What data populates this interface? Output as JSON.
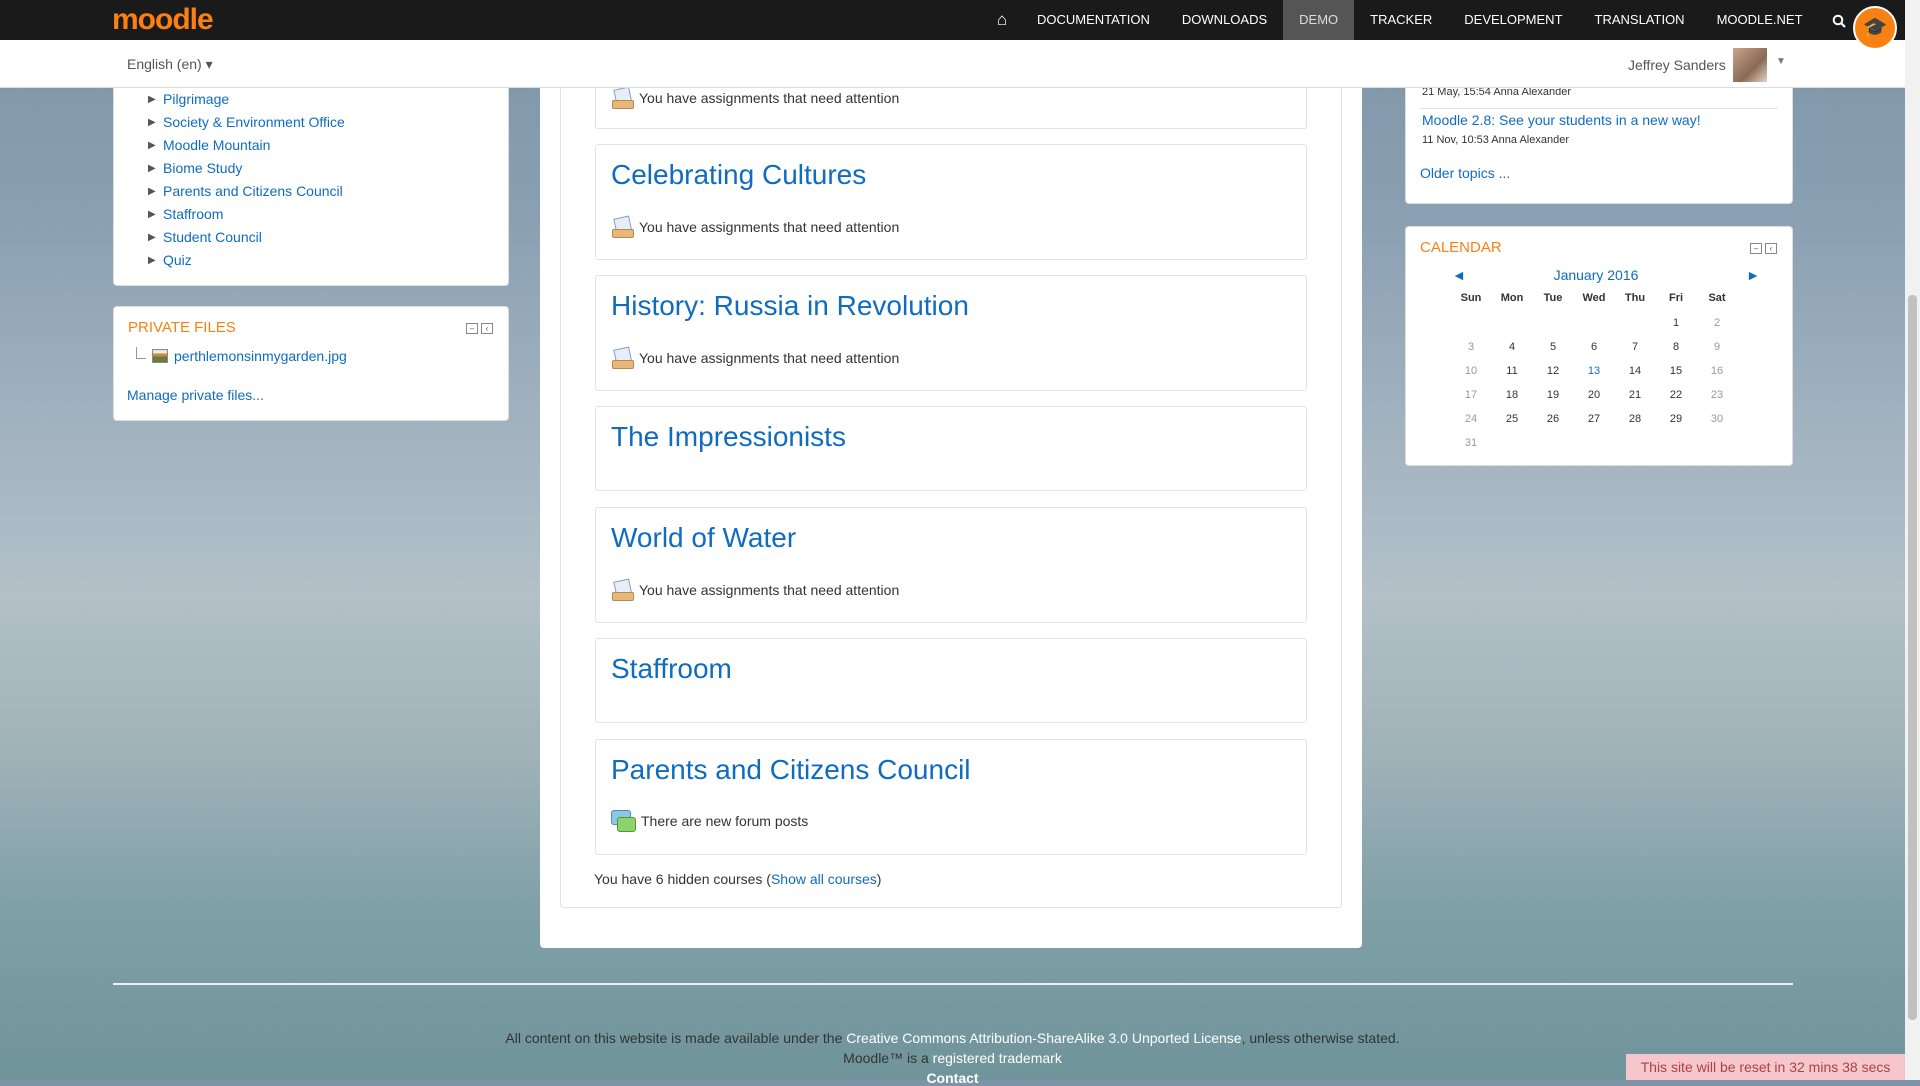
{
  "navbar": {
    "logo": "moodle",
    "home_icon": "⌂",
    "items": [
      "DOCUMENTATION",
      "DOWNLOADS",
      "DEMO",
      "TRACKER",
      "DEVELOPMENT",
      "TRANSLATION",
      "MOODLE.NET"
    ],
    "active_item": "DEMO",
    "search_icon": "search-icon"
  },
  "subbar": {
    "language": "English (en) ▾",
    "user_name": "Jeffrey Sanders"
  },
  "navigation_block": {
    "items": [
      "Pilgrimage",
      "Society & Environment Office",
      "Moodle Mountain",
      "Biome Study",
      "Parents and Citizens Council",
      "Staffroom",
      "Student Council",
      "Quiz"
    ]
  },
  "private_files": {
    "title": "PRIVATE FILES",
    "file": "perthlemonsinmygarden.jpg",
    "manage_link": "Manage private files..."
  },
  "courses": [
    {
      "title": "",
      "notice": "You have assignments that need attention"
    },
    {
      "title": "Celebrating Cultures",
      "notice": "You have assignments that need attention"
    },
    {
      "title": "History: Russia in Revolution",
      "notice": "You have assignments that need attention"
    },
    {
      "title": "The Impressionists",
      "notice": ""
    },
    {
      "title": "World of Water",
      "notice": "You have assignments that need attention"
    },
    {
      "title": "Staffroom",
      "notice": ""
    },
    {
      "title": "Parents and Citizens Council",
      "notice": "There are new forum posts"
    }
  ],
  "hidden_courses": {
    "prefix": "You have 6 hidden courses (",
    "link": "Show all courses",
    "suffix": ")"
  },
  "news": {
    "meta1": "21 May, 15:54  Anna Alexander",
    "link2": "Moodle 2.8: See your students in a new way!",
    "meta2": "11 Nov, 10:53  Anna Alexander",
    "older": "Older topics ..."
  },
  "calendar": {
    "title": "CALENDAR",
    "month": "January 2016",
    "prev": "◄",
    "next": "►",
    "days_of_week": [
      "Sun",
      "Mon",
      "Tue",
      "Wed",
      "Thu",
      "Fri",
      "Sat"
    ],
    "weeks": [
      [
        "",
        "",
        "",
        "",
        "",
        "1",
        "2"
      ],
      [
        "3",
        "4",
        "5",
        "6",
        "7",
        "8",
        "9"
      ],
      [
        "10",
        "11",
        "12",
        "13",
        "14",
        "15",
        "16"
      ],
      [
        "17",
        "18",
        "19",
        "20",
        "21",
        "22",
        "23"
      ],
      [
        "24",
        "25",
        "26",
        "27",
        "28",
        "29",
        "30"
      ],
      [
        "31",
        "",
        "",
        "",
        "",
        "",
        ""
      ]
    ],
    "today": "13"
  },
  "footer": {
    "line1_prefix": "All content on this website is made available under the ",
    "line1_link": "Creative Commons Attribution-ShareAlike 3.0 Unported License",
    "line1_suffix": ", unless otherwise stated.",
    "line2_prefix": "Moodle™ is a ",
    "line2_link": "registered trademark",
    "line3": "Contact",
    "reset": "This site will be reset in 32 mins 38 secs"
  }
}
